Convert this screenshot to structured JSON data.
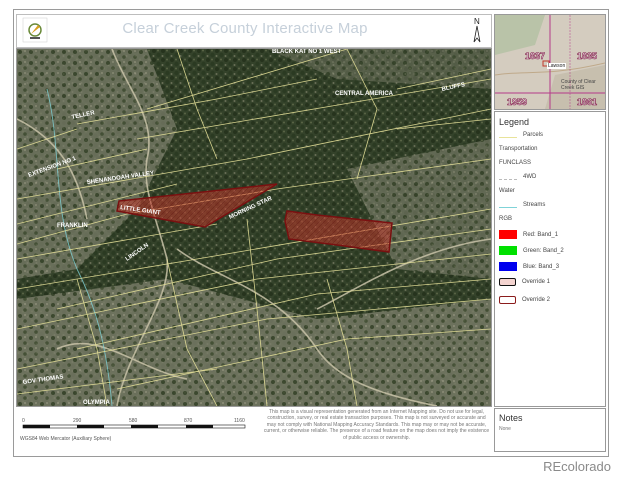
{
  "header": {
    "title": "Clear Creek County Interactive Map"
  },
  "map_labels": {
    "black_kat": "BLACK KAT NO 1 WEST",
    "central_america": "CENTRAL AMERICA",
    "teller": "TELLER",
    "shenandoah": "SHENANDOAH VALLEY",
    "little_giant": "LITTLE GIANT",
    "franklin": "FRANKLIN",
    "morning_star": "MORNING STAR",
    "lincoln": "LINCOLN",
    "gov_thomas": "GOV THOMAS",
    "olympia": "OLYMPIA",
    "extension": "EXTENSION NO 1",
    "bluffs": "BLUFFS"
  },
  "scale": {
    "ticks": [
      "0",
      "290",
      "580",
      "870",
      "1160"
    ],
    "projection": "WGS84 Web Mercator (Auxiliary Sphere)"
  },
  "disclaimer": "This map is a visual representation generated from an Internet Mapping site. Do not use for legal, construction, survey, or real estate transaction purposes. This map is not surveyed or accurate and may not comply with National Mapping Accuracy Standards. This map may or may not be accurate, current, or otherwise reliable. The presence of a road feature on the map does not imply the existence of public access or ownership.",
  "overview": {
    "labels": [
      "1837",
      "1835",
      "1959",
      "1861"
    ],
    "town": "Lawson",
    "caption": "County of Clear Creek GIS"
  },
  "legend": {
    "title": "Legend",
    "items": [
      {
        "label": "Parcels",
        "type": "line",
        "color": "#e8e39a"
      },
      {
        "label": "Transportation",
        "type": "heading"
      },
      {
        "label": "FUNCLASS",
        "type": "heading"
      },
      {
        "label": "4WD",
        "type": "dash",
        "color": "#bbbbbb"
      },
      {
        "label": "Water",
        "type": "heading"
      },
      {
        "label": "Streams",
        "type": "line",
        "color": "#7fd3d8"
      },
      {
        "label": "RGB",
        "type": "heading"
      },
      {
        "label": "Red:   Band_1",
        "type": "fill",
        "color": "#ff0000"
      },
      {
        "label": "Green: Band_2",
        "type": "fill",
        "color": "#00e000"
      },
      {
        "label": "Blue:  Band_3",
        "type": "fill",
        "color": "#0000ee"
      },
      {
        "label": "Override 1",
        "type": "box",
        "color": "#f4d4d0",
        "border": "#111111"
      },
      {
        "label": "Override 2",
        "type": "box",
        "color": "#ffffff",
        "border": "#8b1c1c"
      }
    ]
  },
  "notes": {
    "title": "Notes",
    "text": "None"
  },
  "watermark": "REcolorado",
  "colors": {
    "parcel": "#e8e39a",
    "highlight_fill": "#c0392b",
    "highlight_border": "#7a1010"
  }
}
